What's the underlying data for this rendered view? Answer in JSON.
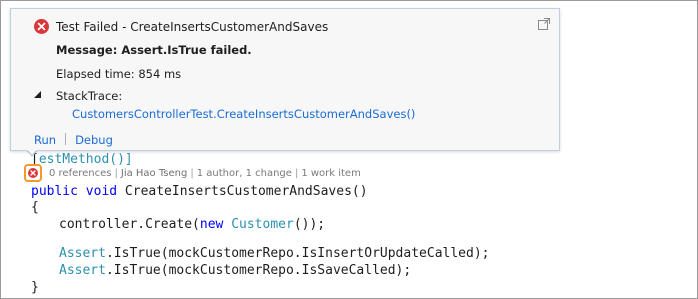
{
  "code": {
    "attribute_tail": "estMethod()]",
    "method_keywords": "public void",
    "method_name": " CreateInsertsCustomerAndSaves()",
    "open_brace": "{",
    "line_create_prefix": "controller.Create(",
    "line_create_new": "new",
    "line_create_type": "Customer",
    "line_create_suffix": "());",
    "assert_type": "Assert",
    "assert1_rest": ".IsTrue(mockCustomerRepo.IsInsertOrUpdateCalled);",
    "assert2_rest": ".IsTrue(mockCustomerRepo.IsSaveCalled);",
    "close_brace": "}"
  },
  "codelens": {
    "references": "0 references",
    "author": "Jia Hao Tseng",
    "changes": "1 author, 1 change",
    "work_items": "1 work item"
  },
  "popup": {
    "title": "Test Failed - CreateInsertsCustomerAndSaves",
    "message": "Message: Assert.IsTrue failed.",
    "elapsed": "Elapsed time: 854 ms",
    "stacktrace_label": "StackTrace:",
    "stacktrace_link": "CustomersControllerTest.CreateInsertsCustomerAndSaves()",
    "run_label": "Run",
    "debug_label": "Debug"
  },
  "colors": {
    "error_red": "#d9383a",
    "badge_orange": "#f29a2b",
    "link_blue": "#1a6bd6",
    "keyword_blue": "#0000ff",
    "type_teal": "#2b91af"
  },
  "icons": {
    "status": "error-x-circle-icon",
    "popout": "popout-window-icon",
    "toggle": "collapse-triangle-icon"
  }
}
